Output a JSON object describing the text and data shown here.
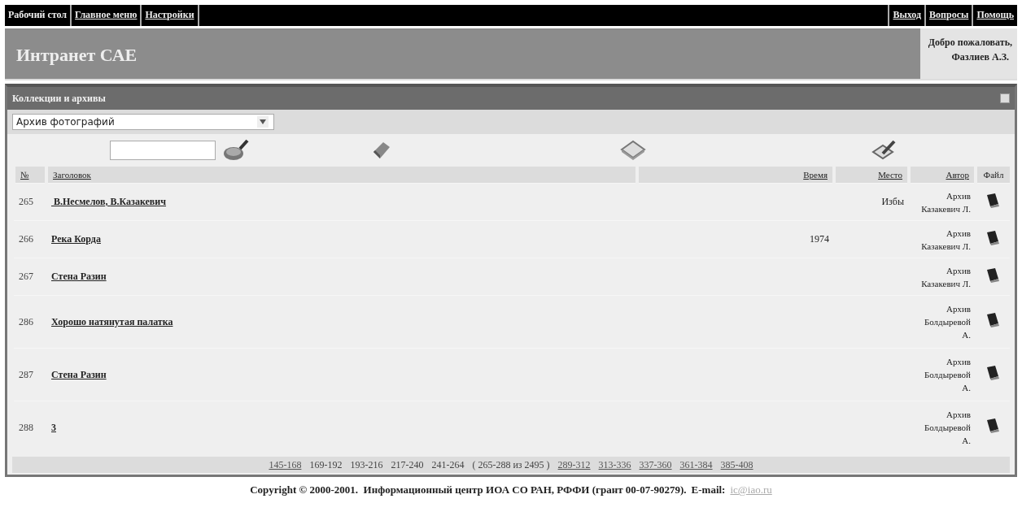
{
  "top_menu": {
    "left": [
      "Рабочий стол",
      "Главное меню",
      "Настройки"
    ],
    "right": [
      "Выход",
      "Вопросы",
      "Помощь"
    ]
  },
  "header": {
    "title": "Интранет САЕ",
    "welcome": "Добро пожаловать,",
    "user": "Фазлиев А.З."
  },
  "panel": {
    "title": "Коллекции и архивы",
    "collection_select": {
      "value": "Архив фотографий"
    },
    "table": {
      "columns": [
        "№",
        "Заголовок",
        "Время",
        "Место",
        "Автор",
        "Файл"
      ],
      "rows": [
        {
          "number": "265",
          "title": " В.Несмелов, В.Казакевич",
          "place": "Избы",
          "author": [
            "Архив",
            "Казакевич Л."
          ]
        },
        {
          "number": "266",
          "title": "Река Корда",
          "time": "1974",
          "author": [
            "Архив",
            "Казакевич Л."
          ]
        },
        {
          "number": "267",
          "title": "Стена Разин",
          "author": [
            "Архив",
            "Казакевич Л."
          ]
        },
        {
          "number": "286",
          "title": "Хорошо натянутая палатка",
          "author": [
            "Архив",
            "Болдыревой",
            "А."
          ]
        },
        {
          "number": "287",
          "title": "Стена Разин",
          "author": [
            "Архив",
            "Болдыревой",
            "А."
          ]
        },
        {
          "number": "288",
          "title": "3",
          "author": [
            "Архив",
            "Болдыревой",
            "А."
          ]
        }
      ]
    },
    "pager": [
      {
        "label": "145-168",
        "link": true
      },
      {
        "label": "169-192",
        "link": false
      },
      {
        "label": "193-216",
        "link": false
      },
      {
        "label": "217-240",
        "link": false
      },
      {
        "label": "241-264",
        "link": false
      },
      {
        "label": "( 265-288 из 2495 )",
        "link": false
      },
      {
        "label": "289-312",
        "link": true
      },
      {
        "label": "313-336",
        "link": true
      },
      {
        "label": "337-360",
        "link": true
      },
      {
        "label": "361-384",
        "link": true
      },
      {
        "label": "385-408",
        "link": true
      }
    ]
  },
  "footer": {
    "text": "Copyright © 2000-2001.  Информационный центр ИОА СО РАН, РФФИ (грант 00-07-90279).",
    "email_label": "E-mail:",
    "email": "ic@iao.ru"
  }
}
